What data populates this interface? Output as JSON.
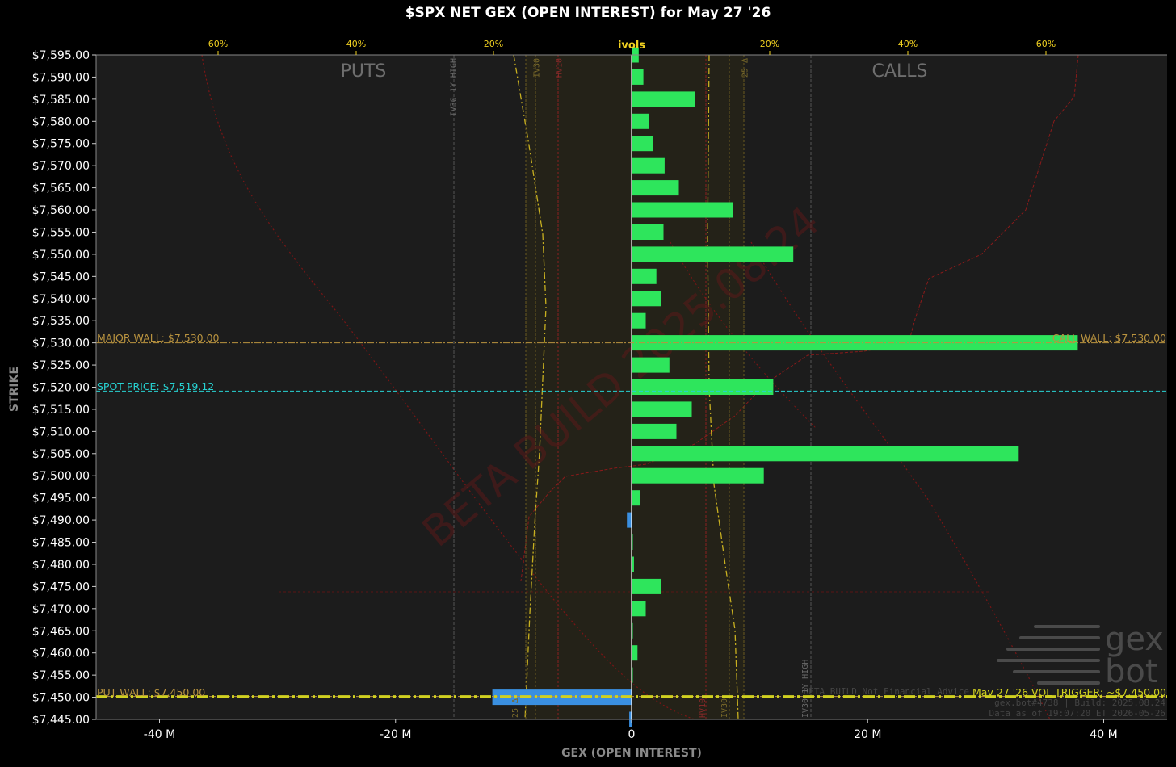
{
  "chart_data": {
    "type": "bar",
    "title": "$SPX NET GEX (OPEN INTEREST) for May 27 '26",
    "xlabel": "GEX (OPEN INTEREST)",
    "ylabel": "STRIKE",
    "top_axis_label": "ivols",
    "top_ticks": [
      "60%",
      "40%",
      "20%",
      "20%",
      "40%",
      "60%"
    ],
    "x_ticks": [
      "-40 M",
      "-20 M",
      "0",
      "20 M",
      "40 M"
    ],
    "xlim": [
      -45.5,
      45.5
    ],
    "ylim": [
      7445,
      7595
    ],
    "strikes": [
      "$7,595.00",
      "$7,590.00",
      "$7,585.00",
      "$7,580.00",
      "$7,575.00",
      "$7,570.00",
      "$7,565.00",
      "$7,560.00",
      "$7,555.00",
      "$7,550.00",
      "$7,545.00",
      "$7,540.00",
      "$7,535.00",
      "$7,530.00",
      "$7,525.00",
      "$7,520.00",
      "$7,515.00",
      "$7,510.00",
      "$7,505.00",
      "$7,500.00",
      "$7,495.00",
      "$7,490.00",
      "$7,485.00",
      "$7,480.00",
      "$7,475.00",
      "$7,470.00",
      "$7,465.00",
      "$7,460.00",
      "$7,455.00",
      "$7,450.00",
      "$7,445.00"
    ],
    "strike_values": [
      7595,
      7590,
      7585,
      7580,
      7575,
      7570,
      7565,
      7560,
      7555,
      7550,
      7545,
      7540,
      7535,
      7530,
      7525,
      7520,
      7515,
      7510,
      7505,
      7500,
      7495,
      7490,
      7485,
      7480,
      7475,
      7470,
      7465,
      7460,
      7455,
      7450,
      7445
    ],
    "gex_values_m": [
      0.6,
      1.0,
      5.4,
      1.5,
      1.8,
      2.8,
      4.0,
      8.6,
      2.7,
      13.7,
      2.1,
      2.5,
      1.2,
      37.8,
      3.2,
      12.0,
      5.1,
      3.8,
      32.8,
      11.2,
      0.7,
      -0.4,
      0.1,
      0.2,
      2.5,
      1.2,
      0.1,
      0.5,
      0.1,
      -11.8,
      -0.2
    ],
    "colors": {
      "call": "#2ee55c",
      "put": "#3a8fe0",
      "background": "#1c1c1c",
      "spot": "#27d2d2",
      "wall": "#c8a84c",
      "trigger": "#d0d020",
      "tick_top": "#f0d020"
    },
    "labels": {
      "puts": "PUTS",
      "calls": "CALLS",
      "major_wall": "MAJOR WALL: $7,530.00",
      "call_wall": "CALL WALL: $7,530.00",
      "spot_price": "SPOT PRICE: $7,519.12",
      "put_wall": "PUT WALL: $7,450.00",
      "vol_trigger": "May 27 '26 VOL TRIGGER: ~$7,450.00",
      "iv30_1y_high_left": "IV30 1Y HIGH",
      "iv30_left": "IV30",
      "hv10_left": "HV10",
      "delta25_right": "25 Δ",
      "iv30_1y_high_right": "IV30 1Y HIGH",
      "iv30_right": "IV30",
      "hv10_right": "HV10",
      "delta25_left": "25 Δ",
      "watermark": "BETA BUILD 2025.08.24",
      "disclaimer": "BETA BUILD Not Financial Advice",
      "build": "gex.bot#4738 | Build: 2025.08.24",
      "data_asof": "Data as of 19:07:20 ET 2026-05-26",
      "logo_top": "gex",
      "logo_bottom": "bot"
    },
    "levels": {
      "major_wall": 7530,
      "spot": 7519.12,
      "put_wall": 7450,
      "vol_trigger": 7450
    }
  }
}
